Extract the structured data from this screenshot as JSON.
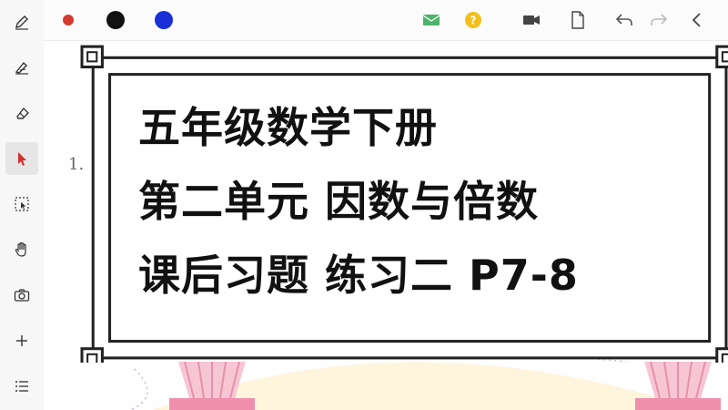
{
  "toolbar": {
    "colors": [
      "#d33b2c",
      "#111111",
      "#1b2fd6"
    ],
    "icons": [
      "mail-icon",
      "help-icon",
      "video-camera-icon",
      "page-icon",
      "undo-icon",
      "redo-icon",
      "back-chevron-icon"
    ]
  },
  "sidebar": {
    "tools": [
      "pen-icon",
      "highlighter-icon",
      "eraser-icon",
      "pointer-icon",
      "select-region-icon",
      "hand-icon",
      "camera-icon",
      "add-icon",
      "menu-icon"
    ]
  },
  "canvas": {
    "side_number": "1."
  },
  "title_card": {
    "lines": [
      "五年级数学下册",
      "第二单元 因数与倍数",
      "课后习题 练习二 P7-8"
    ]
  },
  "accent": "#222222"
}
